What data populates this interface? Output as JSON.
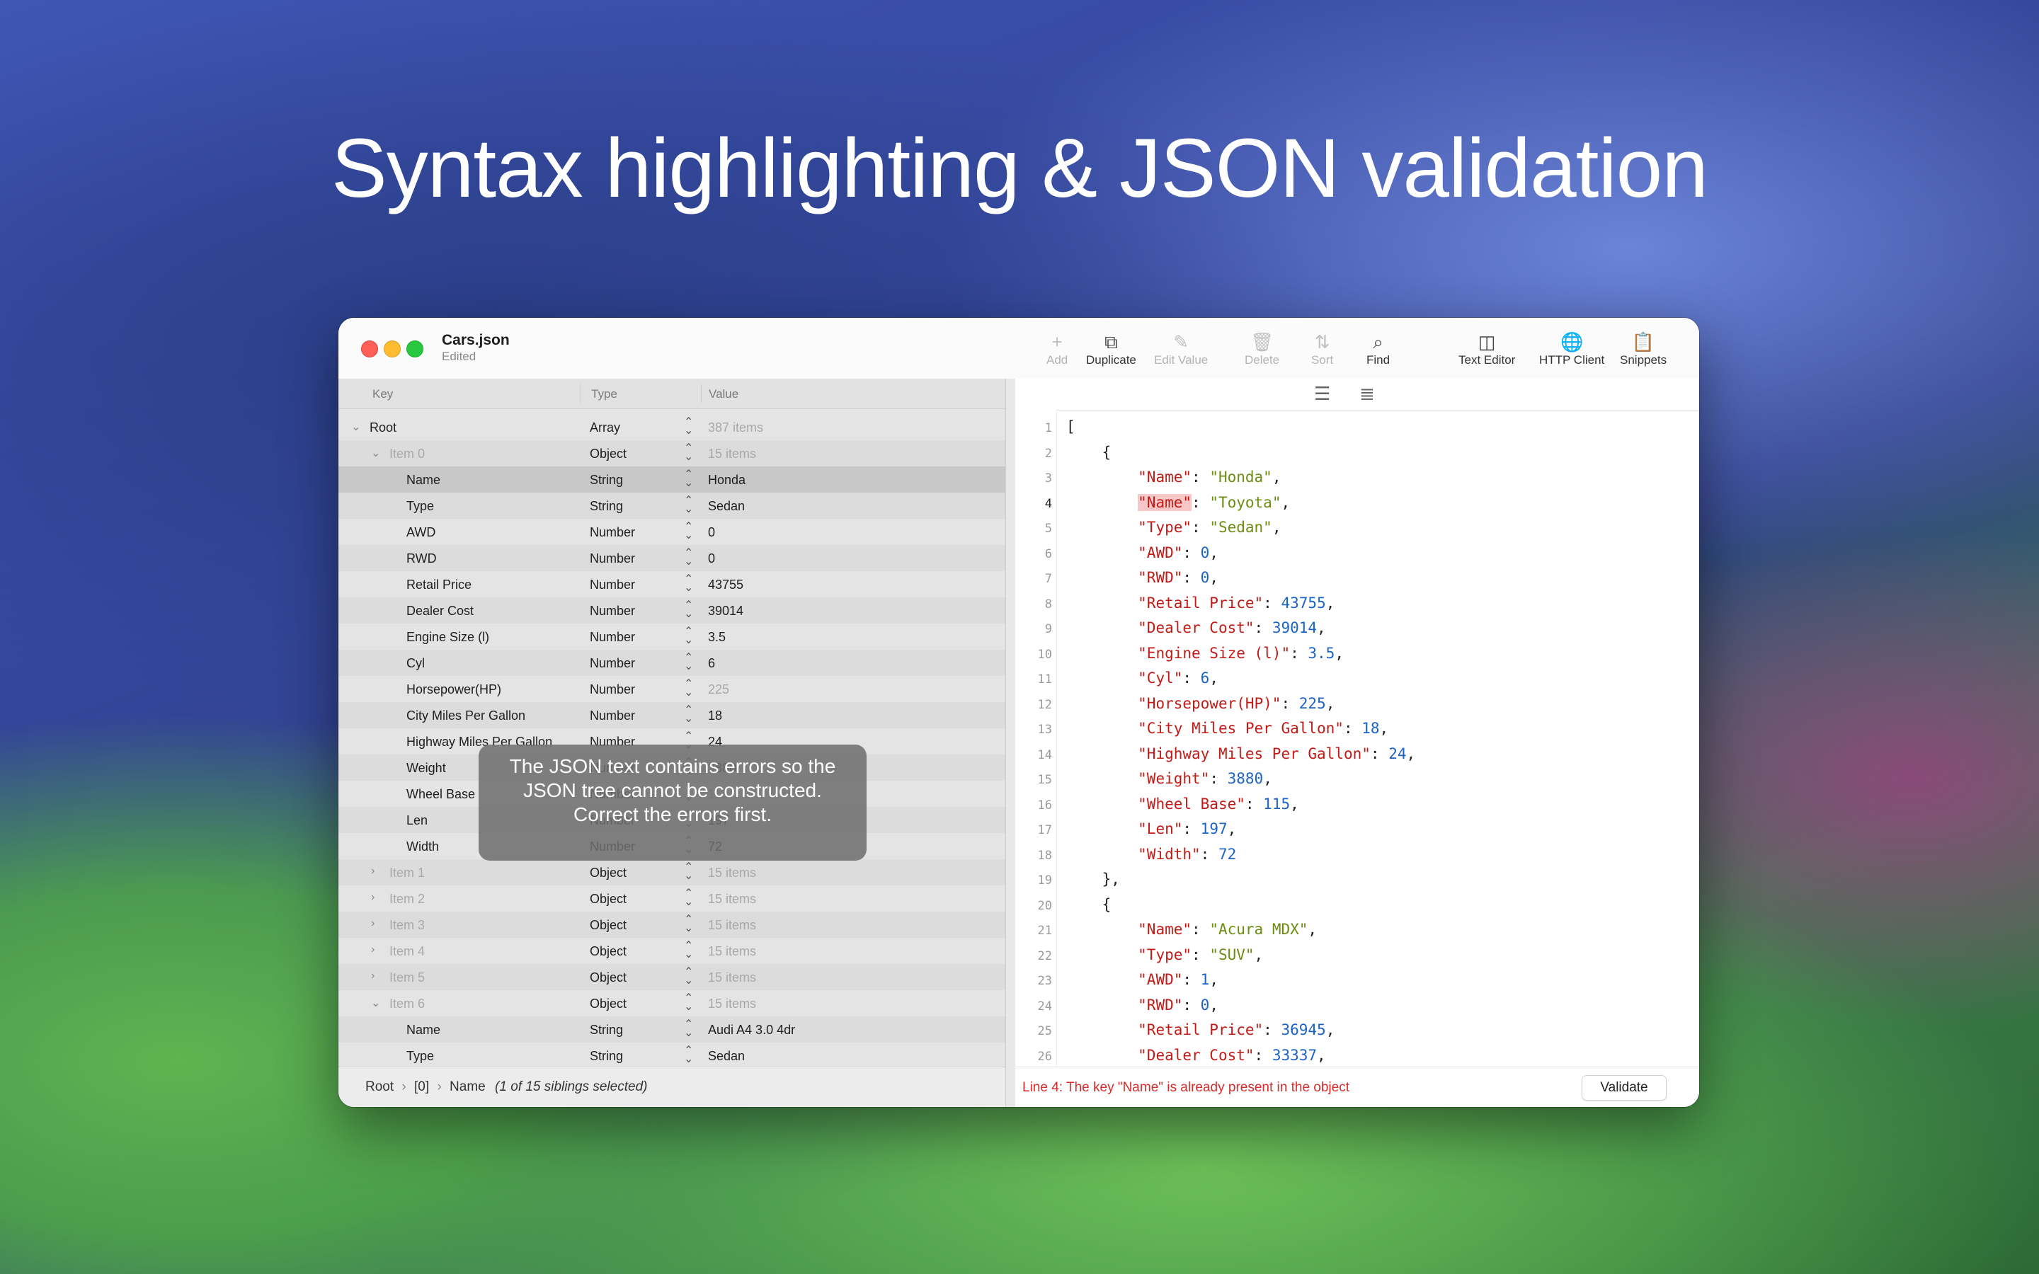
{
  "headline": "Syntax highlighting & JSON validation",
  "window": {
    "title": "Cars.json",
    "subtitle": "Edited"
  },
  "toolbar": [
    {
      "label": "Add",
      "icon": "plus-icon",
      "glyph": "+",
      "disabled": true
    },
    {
      "label": "Duplicate",
      "icon": "duplicate-icon",
      "glyph": "⧉",
      "disabled": false
    },
    {
      "label": "Edit Value",
      "icon": "pencil-icon",
      "glyph": "✎",
      "disabled": true
    },
    {
      "label": "Delete",
      "icon": "trash-icon",
      "glyph": "🗑",
      "disabled": true
    },
    {
      "label": "Sort",
      "icon": "sort-icon",
      "glyph": "⇅",
      "disabled": true
    },
    {
      "label": "Find",
      "icon": "search-icon",
      "glyph": "⌕",
      "disabled": false
    },
    {
      "label": "Text Editor",
      "icon": "sidebar-icon",
      "glyph": "◫",
      "disabled": false
    },
    {
      "label": "HTTP Client",
      "icon": "globe-icon",
      "glyph": "🌐",
      "disabled": false
    },
    {
      "label": "Snippets",
      "icon": "clipboard-icon",
      "glyph": "📋",
      "disabled": false
    }
  ],
  "tree": {
    "headers": {
      "key": "Key",
      "type": "Type",
      "value": "Value"
    },
    "rows": [
      {
        "key": "Root",
        "type": "Array",
        "value": "387 items",
        "level": 0,
        "disclosure": "open",
        "grey_key": false,
        "grey_value": true
      },
      {
        "key": "Item 0",
        "type": "Object",
        "value": "15 items",
        "level": 1,
        "disclosure": "open",
        "grey_key": true,
        "grey_value": true
      },
      {
        "key": "Name",
        "type": "String",
        "value": "Honda",
        "level": 2,
        "disclosure": "",
        "selected": true
      },
      {
        "key": "Type",
        "type": "String",
        "value": "Sedan",
        "level": 2,
        "disclosure": ""
      },
      {
        "key": "AWD",
        "type": "Number",
        "value": "0",
        "level": 2,
        "disclosure": ""
      },
      {
        "key": "RWD",
        "type": "Number",
        "value": "0",
        "level": 2,
        "disclosure": ""
      },
      {
        "key": "Retail Price",
        "type": "Number",
        "value": "43755",
        "level": 2,
        "disclosure": ""
      },
      {
        "key": "Dealer Cost",
        "type": "Number",
        "value": "39014",
        "level": 2,
        "disclosure": ""
      },
      {
        "key": "Engine Size (l)",
        "type": "Number",
        "value": "3.5",
        "level": 2,
        "disclosure": ""
      },
      {
        "key": "Cyl",
        "type": "Number",
        "value": "6",
        "level": 2,
        "disclosure": ""
      },
      {
        "key": "Horsepower(HP)",
        "type": "Number",
        "value": "225",
        "level": 2,
        "disclosure": "",
        "grey_value": true
      },
      {
        "key": "City Miles Per Gallon",
        "type": "Number",
        "value": "18",
        "level": 2,
        "disclosure": ""
      },
      {
        "key": "Highway Miles Per Gallon",
        "type": "Number",
        "value": "24",
        "level": 2,
        "disclosure": ""
      },
      {
        "key": "Weight",
        "type": "Number",
        "value": "3880",
        "level": 2,
        "disclosure": ""
      },
      {
        "key": "Wheel Base",
        "type": "Number",
        "value": "115",
        "level": 2,
        "disclosure": "",
        "grey_value": true
      },
      {
        "key": "Len",
        "type": "Number",
        "value": "197",
        "level": 2,
        "disclosure": ""
      },
      {
        "key": "Width",
        "type": "Number",
        "value": "72",
        "level": 2,
        "disclosure": ""
      },
      {
        "key": "Item 1",
        "type": "Object",
        "value": "15 items",
        "level": 1,
        "disclosure": "closed",
        "grey_key": true,
        "grey_value": true
      },
      {
        "key": "Item 2",
        "type": "Object",
        "value": "15 items",
        "level": 1,
        "disclosure": "closed",
        "grey_key": true,
        "grey_value": true
      },
      {
        "key": "Item 3",
        "type": "Object",
        "value": "15 items",
        "level": 1,
        "disclosure": "closed",
        "grey_key": true,
        "grey_value": true
      },
      {
        "key": "Item 4",
        "type": "Object",
        "value": "15 items",
        "level": 1,
        "disclosure": "closed",
        "grey_key": true,
        "grey_value": true
      },
      {
        "key": "Item 5",
        "type": "Object",
        "value": "15 items",
        "level": 1,
        "disclosure": "closed",
        "grey_key": true,
        "grey_value": true
      },
      {
        "key": "Item 6",
        "type": "Object",
        "value": "15 items",
        "level": 1,
        "disclosure": "open",
        "grey_key": true,
        "grey_value": true
      },
      {
        "key": "Name",
        "type": "String",
        "value": "Audi A4 3.0 4dr",
        "level": 2,
        "disclosure": ""
      },
      {
        "key": "Type",
        "type": "String",
        "value": "Sedan",
        "level": 2,
        "disclosure": ""
      }
    ]
  },
  "overlay": {
    "lines": [
      "The JSON text contains errors so the",
      "JSON tree cannot be constructed.",
      "Correct the errors first."
    ]
  },
  "breadcrumb": {
    "items": [
      "Root",
      "[0]",
      "Name"
    ],
    "note": "(1 of 15 siblings selected)"
  },
  "editor": {
    "current_line": 4,
    "lines": [
      [
        {
          "t": "p",
          "s": "["
        }
      ],
      [
        {
          "t": "p",
          "s": "    {"
        }
      ],
      [
        {
          "t": "p",
          "s": "        "
        },
        {
          "t": "k",
          "s": "\"Name\""
        },
        {
          "t": "p",
          "s": ": "
        },
        {
          "t": "s",
          "s": "\"Honda\""
        },
        {
          "t": "p",
          "s": ","
        }
      ],
      [
        {
          "t": "p",
          "s": "        "
        },
        {
          "t": "ke",
          "s": "\"Name\""
        },
        {
          "t": "p",
          "s": ": "
        },
        {
          "t": "s",
          "s": "\"Toyota\""
        },
        {
          "t": "p",
          "s": ","
        }
      ],
      [
        {
          "t": "p",
          "s": "        "
        },
        {
          "t": "k",
          "s": "\"Type\""
        },
        {
          "t": "p",
          "s": ": "
        },
        {
          "t": "s",
          "s": "\"Sedan\""
        },
        {
          "t": "p",
          "s": ","
        }
      ],
      [
        {
          "t": "p",
          "s": "        "
        },
        {
          "t": "k",
          "s": "\"AWD\""
        },
        {
          "t": "p",
          "s": ": "
        },
        {
          "t": "n",
          "s": "0"
        },
        {
          "t": "p",
          "s": ","
        }
      ],
      [
        {
          "t": "p",
          "s": "        "
        },
        {
          "t": "k",
          "s": "\"RWD\""
        },
        {
          "t": "p",
          "s": ": "
        },
        {
          "t": "n",
          "s": "0"
        },
        {
          "t": "p",
          "s": ","
        }
      ],
      [
        {
          "t": "p",
          "s": "        "
        },
        {
          "t": "k",
          "s": "\"Retail Price\""
        },
        {
          "t": "p",
          "s": ": "
        },
        {
          "t": "n",
          "s": "43755"
        },
        {
          "t": "p",
          "s": ","
        }
      ],
      [
        {
          "t": "p",
          "s": "        "
        },
        {
          "t": "k",
          "s": "\"Dealer Cost\""
        },
        {
          "t": "p",
          "s": ": "
        },
        {
          "t": "n",
          "s": "39014"
        },
        {
          "t": "p",
          "s": ","
        }
      ],
      [
        {
          "t": "p",
          "s": "        "
        },
        {
          "t": "k",
          "s": "\"Engine Size (l)\""
        },
        {
          "t": "p",
          "s": ": "
        },
        {
          "t": "n",
          "s": "3.5"
        },
        {
          "t": "p",
          "s": ","
        }
      ],
      [
        {
          "t": "p",
          "s": "        "
        },
        {
          "t": "k",
          "s": "\"Cyl\""
        },
        {
          "t": "p",
          "s": ": "
        },
        {
          "t": "n",
          "s": "6"
        },
        {
          "t": "p",
          "s": ","
        }
      ],
      [
        {
          "t": "p",
          "s": "        "
        },
        {
          "t": "k",
          "s": "\"Horsepower(HP)\""
        },
        {
          "t": "p",
          "s": ": "
        },
        {
          "t": "n",
          "s": "225"
        },
        {
          "t": "p",
          "s": ","
        }
      ],
      [
        {
          "t": "p",
          "s": "        "
        },
        {
          "t": "k",
          "s": "\"City Miles Per Gallon\""
        },
        {
          "t": "p",
          "s": ": "
        },
        {
          "t": "n",
          "s": "18"
        },
        {
          "t": "p",
          "s": ","
        }
      ],
      [
        {
          "t": "p",
          "s": "        "
        },
        {
          "t": "k",
          "s": "\"Highway Miles Per Gallon\""
        },
        {
          "t": "p",
          "s": ": "
        },
        {
          "t": "n",
          "s": "24"
        },
        {
          "t": "p",
          "s": ","
        }
      ],
      [
        {
          "t": "p",
          "s": "        "
        },
        {
          "t": "k",
          "s": "\"Weight\""
        },
        {
          "t": "p",
          "s": ": "
        },
        {
          "t": "n",
          "s": "3880"
        },
        {
          "t": "p",
          "s": ","
        }
      ],
      [
        {
          "t": "p",
          "s": "        "
        },
        {
          "t": "k",
          "s": "\"Wheel Base\""
        },
        {
          "t": "p",
          "s": ": "
        },
        {
          "t": "n",
          "s": "115"
        },
        {
          "t": "p",
          "s": ","
        }
      ],
      [
        {
          "t": "p",
          "s": "        "
        },
        {
          "t": "k",
          "s": "\"Len\""
        },
        {
          "t": "p",
          "s": ": "
        },
        {
          "t": "n",
          "s": "197"
        },
        {
          "t": "p",
          "s": ","
        }
      ],
      [
        {
          "t": "p",
          "s": "        "
        },
        {
          "t": "k",
          "s": "\"Width\""
        },
        {
          "t": "p",
          "s": ": "
        },
        {
          "t": "n",
          "s": "72"
        }
      ],
      [
        {
          "t": "p",
          "s": "    },"
        }
      ],
      [
        {
          "t": "p",
          "s": "    {"
        }
      ],
      [
        {
          "t": "p",
          "s": "        "
        },
        {
          "t": "k",
          "s": "\"Name\""
        },
        {
          "t": "p",
          "s": ": "
        },
        {
          "t": "s",
          "s": "\"Acura MDX\""
        },
        {
          "t": "p",
          "s": ","
        }
      ],
      [
        {
          "t": "p",
          "s": "        "
        },
        {
          "t": "k",
          "s": "\"Type\""
        },
        {
          "t": "p",
          "s": ": "
        },
        {
          "t": "s",
          "s": "\"SUV\""
        },
        {
          "t": "p",
          "s": ","
        }
      ],
      [
        {
          "t": "p",
          "s": "        "
        },
        {
          "t": "k",
          "s": "\"AWD\""
        },
        {
          "t": "p",
          "s": ": "
        },
        {
          "t": "n",
          "s": "1"
        },
        {
          "t": "p",
          "s": ","
        }
      ],
      [
        {
          "t": "p",
          "s": "        "
        },
        {
          "t": "k",
          "s": "\"RWD\""
        },
        {
          "t": "p",
          "s": ": "
        },
        {
          "t": "n",
          "s": "0"
        },
        {
          "t": "p",
          "s": ","
        }
      ],
      [
        {
          "t": "p",
          "s": "        "
        },
        {
          "t": "k",
          "s": "\"Retail Price\""
        },
        {
          "t": "p",
          "s": ": "
        },
        {
          "t": "n",
          "s": "36945"
        },
        {
          "t": "p",
          "s": ","
        }
      ],
      [
        {
          "t": "p",
          "s": "        "
        },
        {
          "t": "k",
          "s": "\"Dealer Cost\""
        },
        {
          "t": "p",
          "s": ": "
        },
        {
          "t": "n",
          "s": "33337"
        },
        {
          "t": "p",
          "s": ","
        }
      ]
    ],
    "error_message": "Line 4: The key \"Name\" is already present in the object",
    "validate_label": "Validate"
  },
  "colors": {
    "key": "#c41a16",
    "string": "#6d8c10",
    "number": "#1c63c7",
    "error": "#d92b2b"
  }
}
